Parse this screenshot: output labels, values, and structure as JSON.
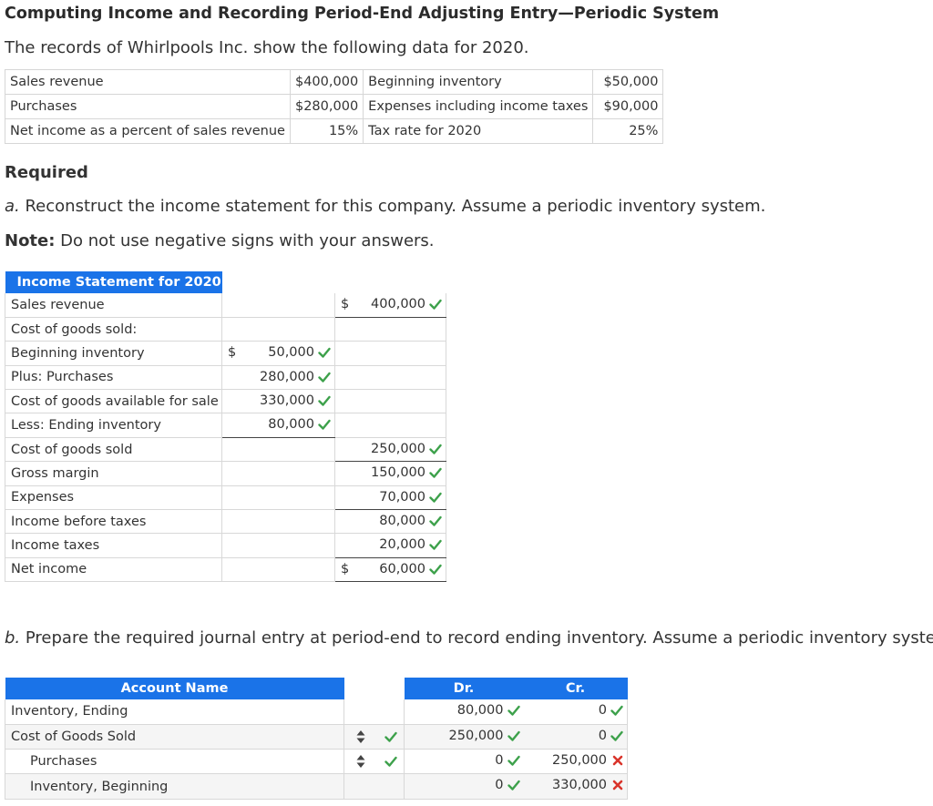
{
  "title": "Computing Income and Recording Period-End Adjusting Entry—Periodic System",
  "intro": "The records of Whirlpools Inc. show the following data for 2020.",
  "given": [
    {
      "l1": "Sales revenue",
      "v1": "$400,000",
      "l2": "Beginning inventory",
      "v2": "$50,000"
    },
    {
      "l1": "Purchases",
      "v1": "$280,000",
      "l2": "Expenses including income taxes",
      "v2": "$90,000"
    },
    {
      "l1": "Net income as a percent of sales revenue",
      "v1": "15%",
      "l2": "Tax rate for 2020",
      "v2": "25%"
    }
  ],
  "required_label": "Required",
  "part_a": {
    "letter": "a.",
    "text": " Reconstruct the income statement for this company. Assume a periodic inventory system."
  },
  "note": {
    "label": "Note:",
    "text": " Do not use negative signs with your answers."
  },
  "income_statement": {
    "header": "Income Statement for 2020",
    "dollar": "$",
    "rows": [
      {
        "label": "Sales revenue",
        "c2": "",
        "c3": "400,000"
      },
      {
        "label": "Cost of goods sold:",
        "c2": "",
        "c3": ""
      },
      {
        "label": "Beginning inventory",
        "c2": "50,000",
        "c3": ""
      },
      {
        "label": "Plus: Purchases",
        "c2": "280,000",
        "c3": ""
      },
      {
        "label": "Cost of goods available for sale",
        "c2": "330,000",
        "c3": ""
      },
      {
        "label": "Less: Ending inventory",
        "c2": "80,000",
        "c3": ""
      },
      {
        "label": "Cost of goods sold",
        "c2": "",
        "c3": "250,000"
      },
      {
        "label": "Gross margin",
        "c2": "",
        "c3": "150,000"
      },
      {
        "label": "Expenses",
        "c2": "",
        "c3": "70,000"
      },
      {
        "label": "Income before taxes",
        "c2": "",
        "c3": "80,000"
      },
      {
        "label": "Income taxes",
        "c2": "",
        "c3": "20,000"
      },
      {
        "label": "Net income",
        "c2": "",
        "c3": "60,000"
      }
    ]
  },
  "part_b": {
    "letter": "b.",
    "text": " Prepare the required journal entry at period-end to record ending inventory. Assume a periodic inventory system."
  },
  "journal": {
    "headers": {
      "account": "Account Name",
      "dr": "Dr.",
      "cr": "Cr."
    },
    "rows": [
      {
        "account": "Inventory, Ending",
        "dr": "80,000",
        "cr": "0",
        "cr_status": "correct"
      },
      {
        "account": "Cost of Goods Sold",
        "dr": "250,000",
        "cr": "0",
        "cr_status": "correct"
      },
      {
        "account": "Purchases",
        "dr": "0",
        "cr": "250,000",
        "cr_status": "incorrect"
      },
      {
        "account": "Inventory, Beginning",
        "dr": "0",
        "cr": "330,000",
        "cr_status": "incorrect"
      }
    ]
  },
  "colors": {
    "header_blue": "#1a73e8",
    "check_green": "#3da14b",
    "error_red": "#d9342b"
  },
  "icons": {
    "correct": "check-icon",
    "incorrect": "x-icon",
    "sort": "up-down-arrow-icon"
  }
}
